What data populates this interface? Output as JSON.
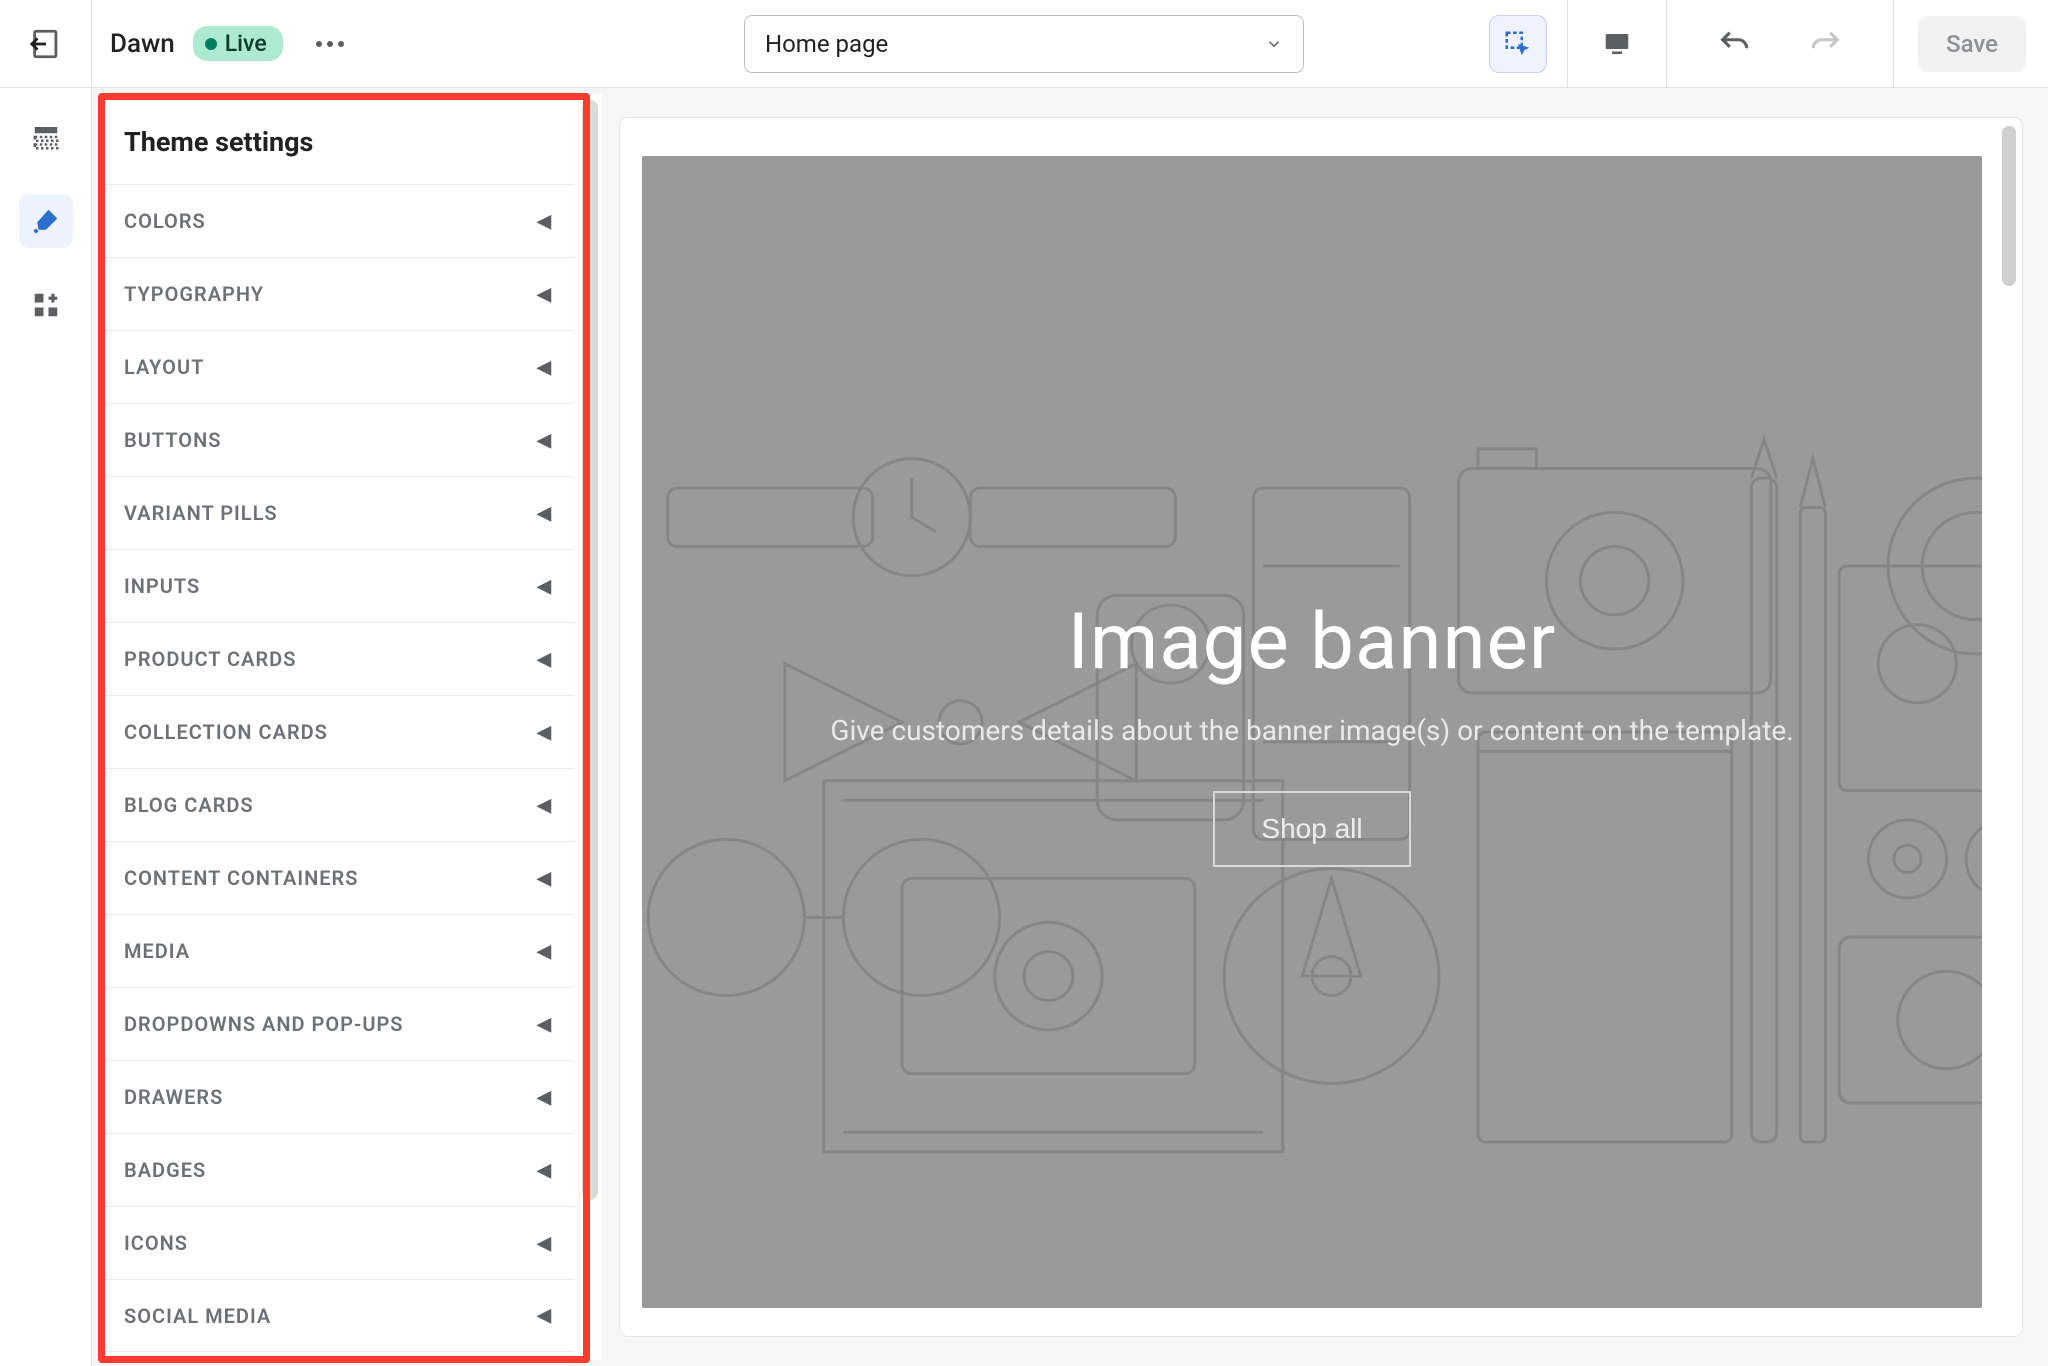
{
  "header": {
    "theme_name": "Dawn",
    "status_label": "Live",
    "page_selector_value": "Home page",
    "save_label": "Save"
  },
  "sidebar": {
    "title": "Theme settings",
    "items": [
      {
        "label": "COLORS"
      },
      {
        "label": "TYPOGRAPHY"
      },
      {
        "label": "LAYOUT"
      },
      {
        "label": "BUTTONS"
      },
      {
        "label": "VARIANT PILLS"
      },
      {
        "label": "INPUTS"
      },
      {
        "label": "PRODUCT CARDS"
      },
      {
        "label": "COLLECTION CARDS"
      },
      {
        "label": "BLOG CARDS"
      },
      {
        "label": "CONTENT CONTAINERS"
      },
      {
        "label": "MEDIA"
      },
      {
        "label": "DROPDOWNS AND POP-UPS"
      },
      {
        "label": "DRAWERS"
      },
      {
        "label": "BADGES"
      },
      {
        "label": "ICONS"
      },
      {
        "label": "SOCIAL MEDIA"
      }
    ]
  },
  "preview": {
    "banner_title": "Image banner",
    "banner_subtitle": "Give customers details about the banner image(s) or content on the template.",
    "banner_button": "Shop all"
  },
  "colors": {
    "accent": "#2c6ecb",
    "badge_bg": "#aee9d1",
    "highlight": "#ff3b30"
  }
}
